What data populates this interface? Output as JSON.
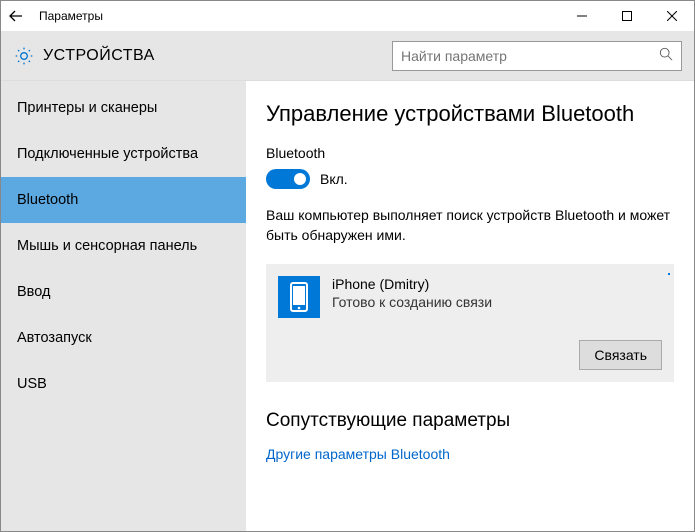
{
  "window": {
    "title": "Параметры"
  },
  "header": {
    "heading": "УСТРОЙСТВА"
  },
  "search": {
    "placeholder": "Найти параметр"
  },
  "sidebar": {
    "items": [
      {
        "label": "Принтеры и сканеры"
      },
      {
        "label": "Подключенные устройства"
      },
      {
        "label": "Bluetooth"
      },
      {
        "label": "Мышь и сенсорная панель"
      },
      {
        "label": "Ввод"
      },
      {
        "label": "Автозапуск"
      },
      {
        "label": "USB"
      }
    ],
    "selected_index": 2
  },
  "main": {
    "title": "Управление устройствами Bluetooth",
    "toggle_label": "Bluetooth",
    "toggle_state_text": "Вкл.",
    "toggle_on": true,
    "status_text": "Ваш компьютер выполняет поиск устройств Bluetooth и может быть обнаружен ими."
  },
  "device": {
    "name": "iPhone (Dmitry)",
    "status": "Готово к созданию связи",
    "pair_button": "Связать",
    "icon": "phone-icon"
  },
  "related": {
    "heading": "Сопутствующие параметры",
    "link": "Другие параметры Bluetooth"
  }
}
